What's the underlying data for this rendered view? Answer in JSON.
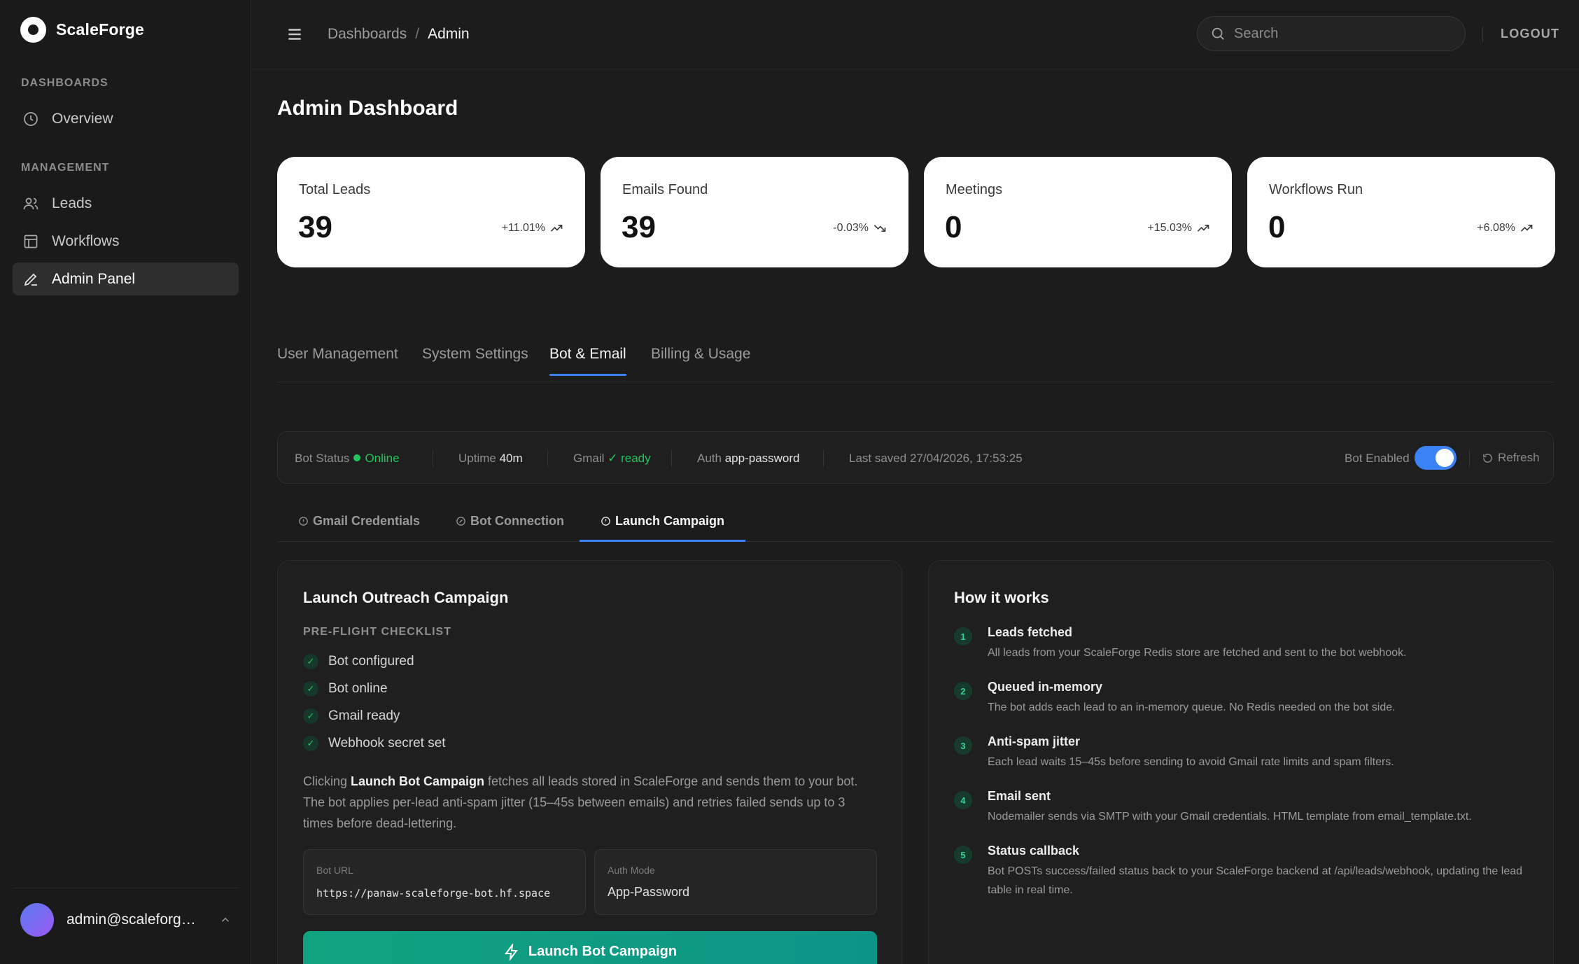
{
  "brand": {
    "name": "ScaleForge"
  },
  "sidebar": {
    "sections": [
      {
        "label": "DASHBOARDS"
      },
      {
        "label": "MANAGEMENT"
      }
    ],
    "items": [
      {
        "label": "Overview",
        "icon": "clock-icon"
      },
      {
        "label": "Leads",
        "icon": "users-icon"
      },
      {
        "label": "Workflows",
        "icon": "layout-icon"
      },
      {
        "label": "Admin Panel",
        "icon": "pencil-icon",
        "active": true
      }
    ],
    "user": {
      "email": "admin@scaleforge..."
    }
  },
  "topbar": {
    "breadcrumb": [
      "Dashboards",
      "/",
      "Admin"
    ],
    "search_placeholder": "Search",
    "logout_label": "LOGOUT"
  },
  "page": {
    "title": "Admin Dashboard"
  },
  "stats": [
    {
      "label": "Total Leads",
      "value": "39",
      "change": "+11.01%",
      "trend": "up"
    },
    {
      "label": "Emails Found",
      "value": "39",
      "change": "-0.03%",
      "trend": "down"
    },
    {
      "label": "Meetings",
      "value": "0",
      "change": "+15.03%",
      "trend": "up"
    },
    {
      "label": "Workflows Run",
      "value": "0",
      "change": "+6.08%",
      "trend": "up"
    }
  ],
  "tabs": [
    {
      "label": "User Management"
    },
    {
      "label": "System Settings"
    },
    {
      "label": "Bot & Email",
      "active": true
    },
    {
      "label": "Billing & Usage"
    }
  ],
  "status_bar": {
    "bot_status_label": "Bot Status",
    "bot_status_value": "Online",
    "uptime_label": "Uptime",
    "uptime_value": "40m",
    "gmail_label": "Gmail",
    "gmail_value": "✓ ready",
    "auth_label": "Auth",
    "auth_value": "app-password",
    "last_saved": "Last saved 27/04/2026, 17:53:25",
    "bot_enabled_label": "Bot Enabled",
    "bot_enabled": true,
    "refresh_label": "Refresh"
  },
  "subtabs": [
    {
      "label": "Gmail Credentials"
    },
    {
      "label": "Bot Connection"
    },
    {
      "label": "Launch Campaign",
      "active": true
    }
  ],
  "campaign": {
    "title": "Launch Outreach Campaign",
    "checklist_label": "PRE-FLIGHT CHECKLIST",
    "checklist": [
      "Bot configured",
      "Bot online",
      "Gmail ready",
      "Webhook secret set"
    ],
    "desc_pre": "Clicking ",
    "desc_bold": "Launch Bot Campaign",
    "desc_post": " fetches all leads stored in ScaleForge and sends them to your bot. The bot applies per-lead anti-spam jitter (15–45s between emails) and retries failed sends up to 3 times before dead-lettering.",
    "bot_url_label": "Bot URL",
    "bot_url_value": "https://panaw-scaleforge-bot.hf.space",
    "auth_mode_label": "Auth Mode",
    "auth_mode_value": "App-Password",
    "launch_label": "Launch Bot Campaign"
  },
  "how": {
    "title": "How it works",
    "steps": [
      {
        "num": "1",
        "title": "Leads fetched",
        "text": "All leads from your ScaleForge Redis store are fetched and sent to the bot webhook."
      },
      {
        "num": "2",
        "title": "Queued in-memory",
        "text": "The bot adds each lead to an in-memory queue. No Redis needed on the bot side."
      },
      {
        "num": "3",
        "title": "Anti-spam jitter",
        "text": "Each lead waits 15–45s before sending to avoid Gmail rate limits and spam filters."
      },
      {
        "num": "4",
        "title": "Email sent",
        "text": "Nodemailer sends via SMTP with your Gmail credentials. HTML template from email_template.txt."
      },
      {
        "num": "5",
        "title": "Status callback",
        "text": "Bot POSTs success/failed status back to your ScaleForge backend at /api/leads/webhook, updating the lead table in real time."
      }
    ]
  },
  "colors": {
    "accent": "#3b82f6",
    "success": "#22c55e",
    "launch": "#10a37f"
  }
}
